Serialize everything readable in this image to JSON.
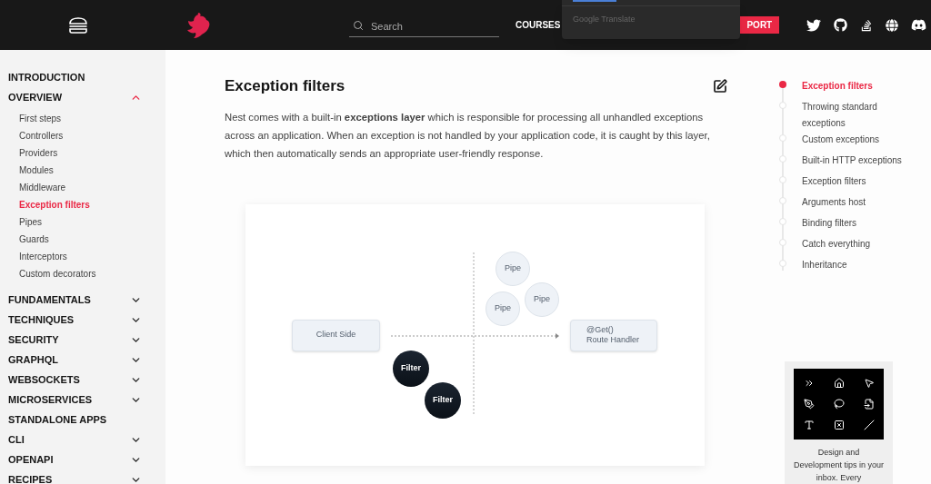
{
  "header": {
    "search": {
      "placeholder": "Search"
    },
    "nav": [
      "COURSES"
    ],
    "support_button": "PORT",
    "translate_popup": {
      "label": "Google Translate"
    }
  },
  "sidebar": {
    "sections": [
      {
        "kind": "link",
        "label": "INTRODUCTION"
      },
      {
        "kind": "group",
        "label": "OVERVIEW",
        "expanded": true,
        "children": [
          {
            "label": "First steps",
            "selected": false
          },
          {
            "label": "Controllers",
            "selected": false
          },
          {
            "label": "Providers",
            "selected": false
          },
          {
            "label": "Modules",
            "selected": false
          },
          {
            "label": "Middleware",
            "selected": false
          },
          {
            "label": "Exception filters",
            "selected": true
          },
          {
            "label": "Pipes",
            "selected": false
          },
          {
            "label": "Guards",
            "selected": false
          },
          {
            "label": "Interceptors",
            "selected": false
          },
          {
            "label": "Custom decorators",
            "selected": false
          }
        ]
      },
      {
        "kind": "group",
        "label": "FUNDAMENTALS",
        "expanded": false
      },
      {
        "kind": "group",
        "label": "TECHNIQUES",
        "expanded": false
      },
      {
        "kind": "group",
        "label": "SECURITY",
        "expanded": false
      },
      {
        "kind": "group",
        "label": "GRAPHQL",
        "expanded": false
      },
      {
        "kind": "group",
        "label": "WEBSOCKETS",
        "expanded": false
      },
      {
        "kind": "group",
        "label": "MICROSERVICES",
        "expanded": false
      },
      {
        "kind": "link",
        "label": "STANDALONE APPS"
      },
      {
        "kind": "group",
        "label": "CLI",
        "expanded": false
      },
      {
        "kind": "group",
        "label": "OPENAPI",
        "expanded": false
      },
      {
        "kind": "group",
        "label": "RECIPES",
        "expanded": false
      }
    ]
  },
  "article": {
    "title": "Exception filters",
    "paragraph": "Nest comes with a built-in **exceptions layer** which is responsible for processing all unhandled exceptions across an application. When an exception is not handled by your application code, it is caught by this layer, which then automatically sends an appropriate user-friendly response.",
    "diagram": {
      "nodes": [
        {
          "kind": "box",
          "label": "Client Side"
        },
        {
          "kind": "box",
          "label": "@Get()\nRoute Handler"
        },
        {
          "kind": "pipe",
          "label": "Pipe"
        },
        {
          "kind": "pipe",
          "label": "Pipe"
        },
        {
          "kind": "pipe",
          "label": "Pipe"
        },
        {
          "kind": "filter",
          "label": "Filter"
        },
        {
          "kind": "filter",
          "label": "Filter"
        }
      ]
    }
  },
  "toc": [
    {
      "label": "Exception filters",
      "selected": true
    },
    {
      "label": "Throwing standard exceptions",
      "selected": false
    },
    {
      "label": "Custom exceptions",
      "selected": false
    },
    {
      "label": "Built-in HTTP exceptions",
      "selected": false
    },
    {
      "label": "Exception filters",
      "selected": false
    },
    {
      "label": "Arguments host",
      "selected": false
    },
    {
      "label": "Binding filters",
      "selected": false
    },
    {
      "label": "Catch everything",
      "selected": false
    },
    {
      "label": "Inheritance",
      "selected": false
    }
  ],
  "ad": {
    "text": "Design and Development tips in your inbox. Every"
  }
}
